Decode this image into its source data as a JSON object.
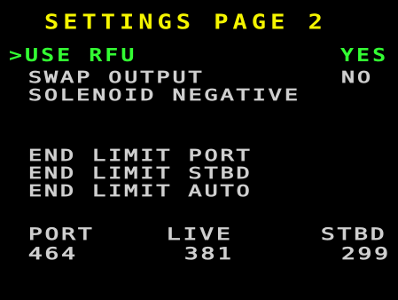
{
  "colors": {
    "background": "#000000",
    "title": "#f5f500",
    "selected": "#33ff33",
    "normal": "#cfcfcf"
  },
  "title": "SETTINGS PAGE 2",
  "options": [
    {
      "label": ">USE RFU",
      "value": "YES",
      "selected": true
    },
    {
      "label": "SWAP OUTPUT",
      "value": "NO",
      "selected": false
    },
    {
      "label": "SOLENOID NEGATIVE",
      "value": "",
      "selected": false
    }
  ],
  "limits": [
    {
      "label": "END LIMIT PORT"
    },
    {
      "label": "END LIMIT STBD"
    },
    {
      "label": "END LIMIT AUTO"
    }
  ],
  "readout": {
    "port_label": "PORT",
    "live_label": "LIVE",
    "stbd_label": "STBD",
    "port_value": "464",
    "live_value": "381",
    "stbd_value": "299"
  }
}
